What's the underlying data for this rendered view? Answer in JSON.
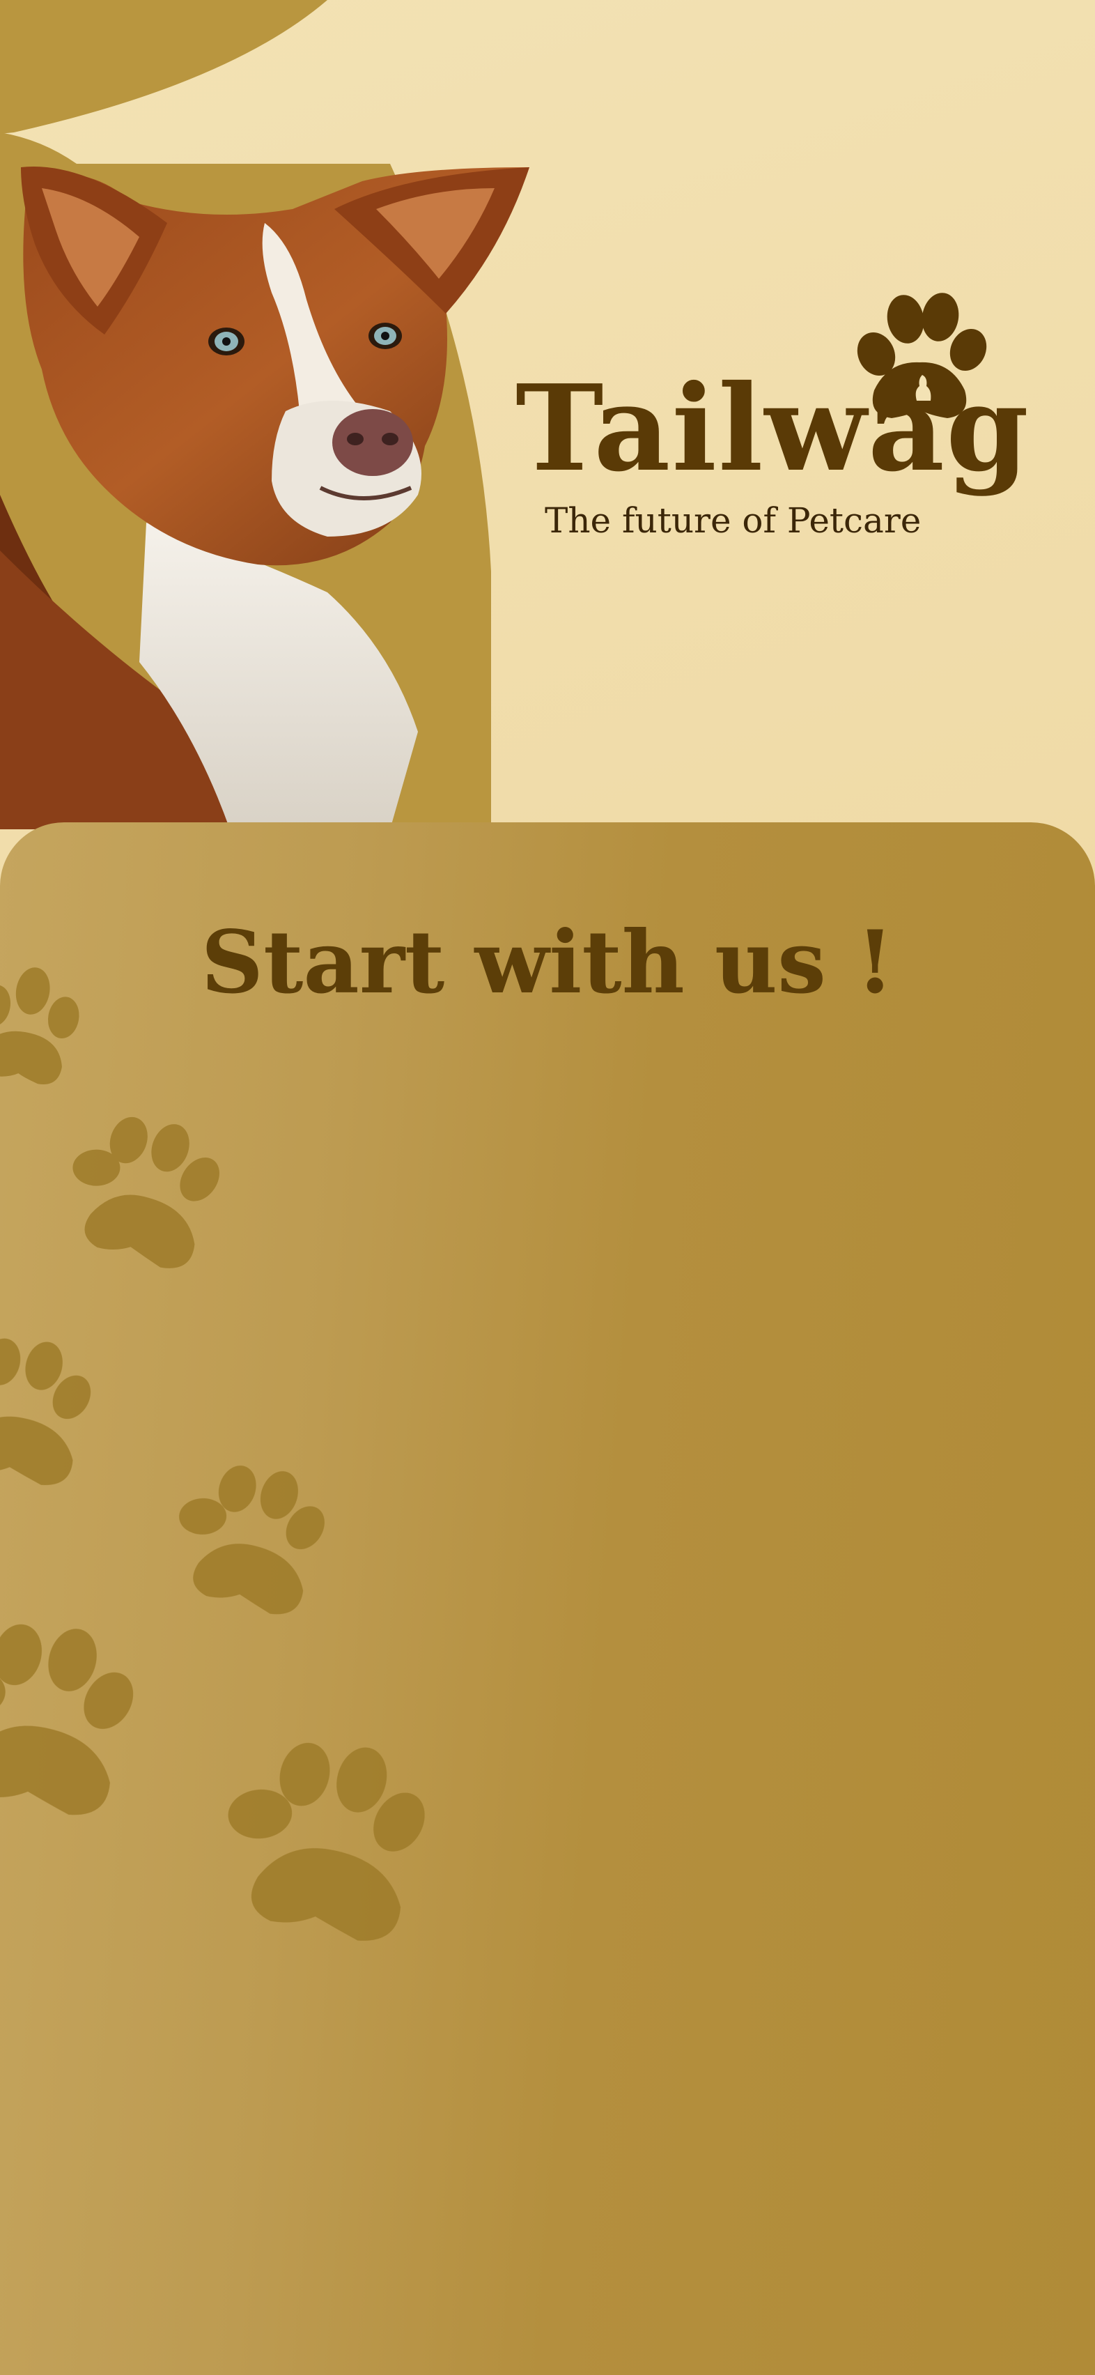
{
  "brand": {
    "name": "Tailwag",
    "tagline": "The future of Petcare",
    "logo_icon": "paw-icon"
  },
  "hero": {
    "image": "dog-portrait",
    "description_icon": "dog-illustration"
  },
  "panel": {
    "title": "Start with us !",
    "decoration_icon": "paw-print-icon"
  },
  "colors": {
    "background": "#f1ddac",
    "accent_olive": "#b48f3e",
    "brand_brown": "#5a3a06",
    "tagline_brown": "#3b2608",
    "paw_print": "#9f7c2b"
  }
}
